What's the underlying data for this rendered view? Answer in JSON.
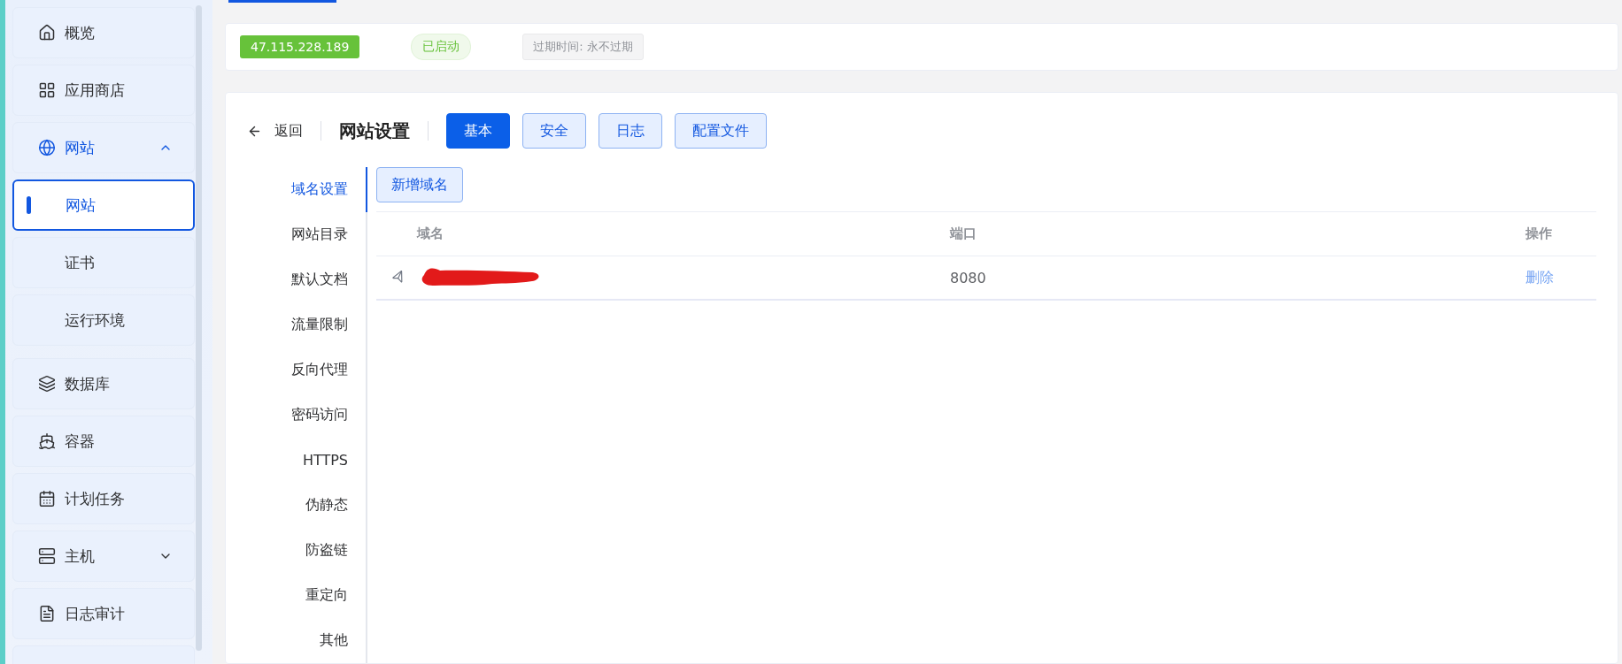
{
  "sidebar": {
    "items": [
      {
        "label": "概览",
        "kind": "link"
      },
      {
        "label": "应用商店",
        "kind": "link"
      },
      {
        "label": "网站",
        "kind": "group",
        "expanded": true,
        "children": [
          {
            "label": "网站",
            "selected": true
          },
          {
            "label": "证书",
            "selected": false
          },
          {
            "label": "运行环境",
            "selected": false
          }
        ]
      },
      {
        "label": "数据库",
        "kind": "link"
      },
      {
        "label": "容器",
        "kind": "link"
      },
      {
        "label": "计划任务",
        "kind": "link"
      },
      {
        "label": "主机",
        "kind": "group",
        "expanded": false
      },
      {
        "label": "日志审计",
        "kind": "link"
      }
    ]
  },
  "info": {
    "ip": "47.115.228.189",
    "status": "已启动",
    "expiry": "过期时间: 永不过期"
  },
  "header": {
    "back": "返回",
    "title": "网站设置",
    "tabs": [
      {
        "label": "基本",
        "selected": true
      },
      {
        "label": "安全",
        "selected": false
      },
      {
        "label": "日志",
        "selected": false
      },
      {
        "label": "配置文件",
        "selected": false
      }
    ]
  },
  "settings_menu": [
    {
      "label": "域名设置",
      "selected": true
    },
    {
      "label": "网站目录",
      "selected": false
    },
    {
      "label": "默认文档",
      "selected": false
    },
    {
      "label": "流量限制",
      "selected": false
    },
    {
      "label": "反向代理",
      "selected": false
    },
    {
      "label": "密码访问",
      "selected": false
    },
    {
      "label": "HTTPS",
      "selected": false
    },
    {
      "label": "伪静态",
      "selected": false
    },
    {
      "label": "防盗链",
      "selected": false
    },
    {
      "label": "重定向",
      "selected": false
    },
    {
      "label": "其他",
      "selected": false
    }
  ],
  "add_button": "新增域名",
  "table": {
    "columns": [
      "域名",
      "端口",
      "操作"
    ],
    "rows": [
      {
        "domain_redacted": true,
        "port": "8080",
        "action": "删除"
      }
    ]
  }
}
